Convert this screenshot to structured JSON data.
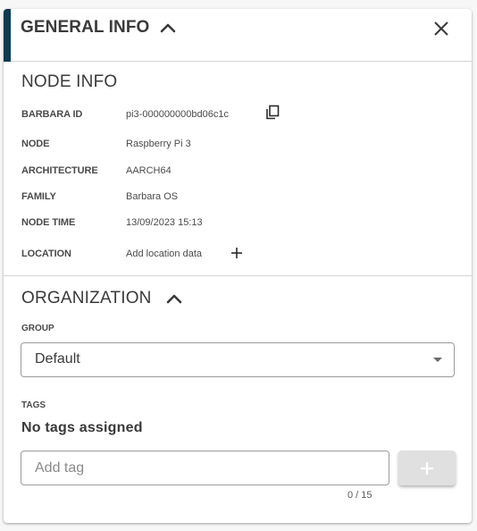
{
  "header": {
    "title": "GENERAL INFO"
  },
  "node_info": {
    "title": "NODE INFO",
    "rows": [
      {
        "label": "BARBARA ID",
        "value": "pi3-000000000bd06c1c"
      },
      {
        "label": "NODE",
        "value": "Raspberry Pi 3"
      },
      {
        "label": "ARCHITECTURE",
        "value": "AARCH64"
      },
      {
        "label": "FAMILY",
        "value": "Barbara OS"
      },
      {
        "label": "NODE TIME",
        "value": "13/09/2023 15:13"
      },
      {
        "label": "LOCATION",
        "value": "Add location data"
      }
    ]
  },
  "organization": {
    "title": "ORGANIZATION",
    "group_label": "GROUP",
    "group_value": "Default",
    "tags_label": "TAGS",
    "no_tags_text": "No tags assigned",
    "tag_placeholder": "Add tag",
    "counter": "0 / 15"
  },
  "icons": {
    "header_toggle": "chevron-up-icon",
    "close": "close-icon",
    "copy": "copy-icon",
    "add_location": "plus-icon",
    "org_toggle": "chevron-up-icon",
    "select_arrow": "caret-down-icon",
    "add_tag": "plus-icon"
  },
  "colors": {
    "accent": "#0d3b4f",
    "disabled_button": "#e0e0e0"
  }
}
